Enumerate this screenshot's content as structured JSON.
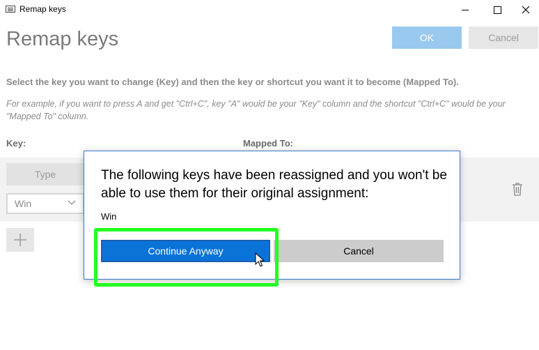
{
  "window": {
    "title": "Remap keys"
  },
  "header": {
    "title": "Remap keys",
    "ok_label": "OK",
    "cancel_label": "Cancel"
  },
  "instructions": {
    "main": "Select the key you want to change (Key) and then the key or shortcut you want it to become (Mapped To).",
    "example": "For example, if you want to press A and get \"Ctrl+C\", key \"A\" would be your \"Key\" column and the shortcut \"Ctrl+C\" would be your \"Mapped To\" column."
  },
  "columns": {
    "key": "Key:",
    "mapped_to": "Mapped To:"
  },
  "row": {
    "type_label": "Type",
    "selected_key": "Win"
  },
  "dialog": {
    "message": "The following keys have been reassigned and you won't be able to use them for their original assignment:",
    "keys": "Win",
    "continue_label": "Continue Anyway",
    "cancel_label": "Cancel"
  },
  "colors": {
    "accent": "#0a73d8",
    "highlight": "#22ff22",
    "ok_disabled": "#99c9ef"
  },
  "icons": [
    "keyboard-icon",
    "minimize-icon",
    "maximize-icon",
    "close-icon",
    "chevron-down-icon",
    "trash-icon",
    "plus-icon",
    "mouse-cursor-icon"
  ]
}
